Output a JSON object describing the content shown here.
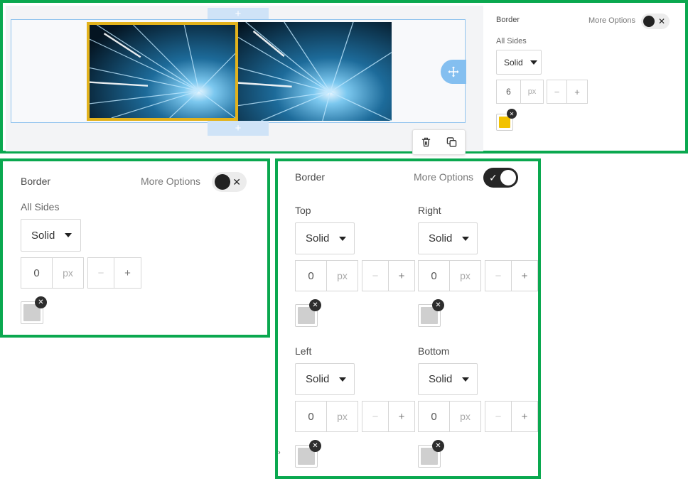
{
  "top_panel": {
    "border_label": "Border",
    "more_options_label": "More Options",
    "all_sides_label": "All Sides",
    "style_value": "Solid",
    "width_value": "6",
    "unit_label": "px",
    "decrement_label": "−",
    "increment_label": "+",
    "color": "#f2c200",
    "more_options_on": false
  },
  "canvas": {
    "add_label": "+"
  },
  "left_panel": {
    "border_label": "Border",
    "more_options_label": "More Options",
    "all_sides_label": "All Sides",
    "style_value": "Solid",
    "width_value": "0",
    "unit_label": "px",
    "decrement_label": "−",
    "increment_label": "+",
    "color": "#cfcfcf",
    "more_options_on": false
  },
  "right_panel": {
    "border_label": "Border",
    "more_options_label": "More Options",
    "more_options_on": true,
    "sides": [
      {
        "label": "Top",
        "style": "Solid",
        "width": "0",
        "unit": "px",
        "minus": "−",
        "plus": "+",
        "color": "#cfcfcf"
      },
      {
        "label": "Right",
        "style": "Solid",
        "width": "0",
        "unit": "px",
        "minus": "−",
        "plus": "+",
        "color": "#cfcfcf"
      },
      {
        "label": "Left",
        "style": "Solid",
        "width": "0",
        "unit": "px",
        "minus": "−",
        "plus": "+",
        "color": "#cfcfcf"
      },
      {
        "label": "Bottom",
        "style": "Solid",
        "width": "0",
        "unit": "px",
        "minus": "−",
        "plus": "+",
        "color": "#cfcfcf"
      }
    ]
  },
  "colors": {
    "highlight_frame": "#0aa84f",
    "selection": "#e2b21c",
    "canvas_accent": "#84bff0"
  }
}
